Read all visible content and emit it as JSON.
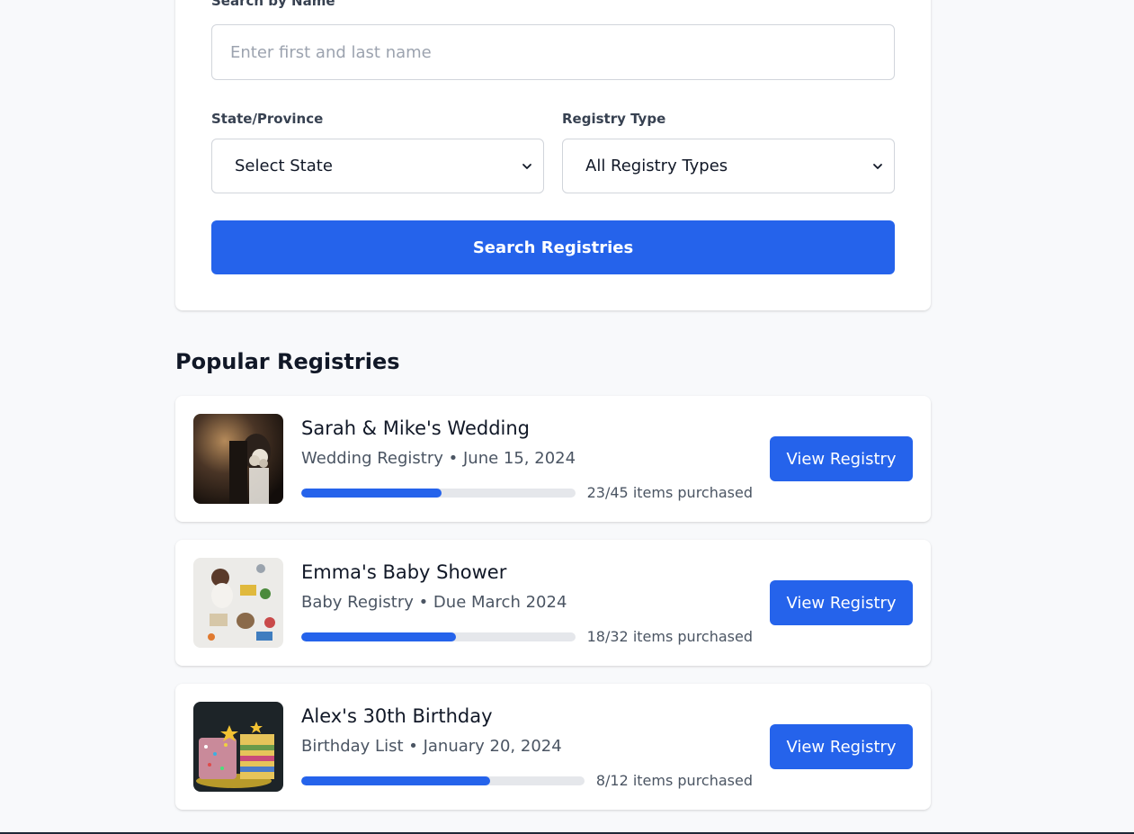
{
  "search": {
    "name_label": "Search by Name",
    "name_placeholder": "Enter first and last name",
    "name_value": "",
    "state_label": "State/Province",
    "state_value": "Select State",
    "type_label": "Registry Type",
    "type_value": "All Registry Types",
    "button_label": "Search Registries"
  },
  "popular": {
    "title": "Popular Registries",
    "view_label": "View Registry",
    "items": [
      {
        "name": "Sarah & Mike's Wedding",
        "meta": "Wedding Registry • June 15, 2024",
        "purchased": 23,
        "total": 45,
        "progress_text": "23/45 items purchased",
        "image": "wedding-photo"
      },
      {
        "name": "Emma's Baby Shower",
        "meta": "Baby Registry • Due March 2024",
        "purchased": 18,
        "total": 32,
        "progress_text": "18/32 items purchased",
        "image": "baby-photo"
      },
      {
        "name": "Alex's 30th Birthday",
        "meta": "Birthday List • January 20, 2024",
        "purchased": 8,
        "total": 12,
        "progress_text": "8/12 items purchased",
        "image": "birthday-cake-photo"
      }
    ]
  },
  "colors": {
    "accent": "#2563eb",
    "background": "#f8f9fb",
    "track": "#e5e7eb"
  }
}
